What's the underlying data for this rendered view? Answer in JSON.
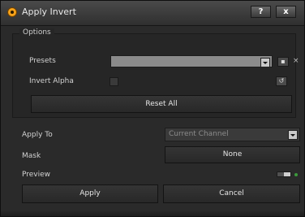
{
  "window": {
    "title": "Apply Invert"
  },
  "titlebar": {
    "help_label": "?",
    "close_label": "x"
  },
  "options": {
    "group_title": "Options",
    "presets_label": "Presets",
    "presets_value": "",
    "invert_alpha_label": "Invert Alpha",
    "reset_label": "Reset All"
  },
  "apply_to": {
    "label": "Apply To",
    "value": "Current Channel"
  },
  "mask": {
    "label": "Mask",
    "value": "None"
  },
  "preview": {
    "label": "Preview",
    "enabled": true
  },
  "footer": {
    "apply_label": "Apply",
    "cancel_label": "Cancel"
  },
  "colors": {
    "accent": "#f6a21a",
    "window_bg": "#2a2a2a",
    "field_bg": "#8b8b8b"
  }
}
